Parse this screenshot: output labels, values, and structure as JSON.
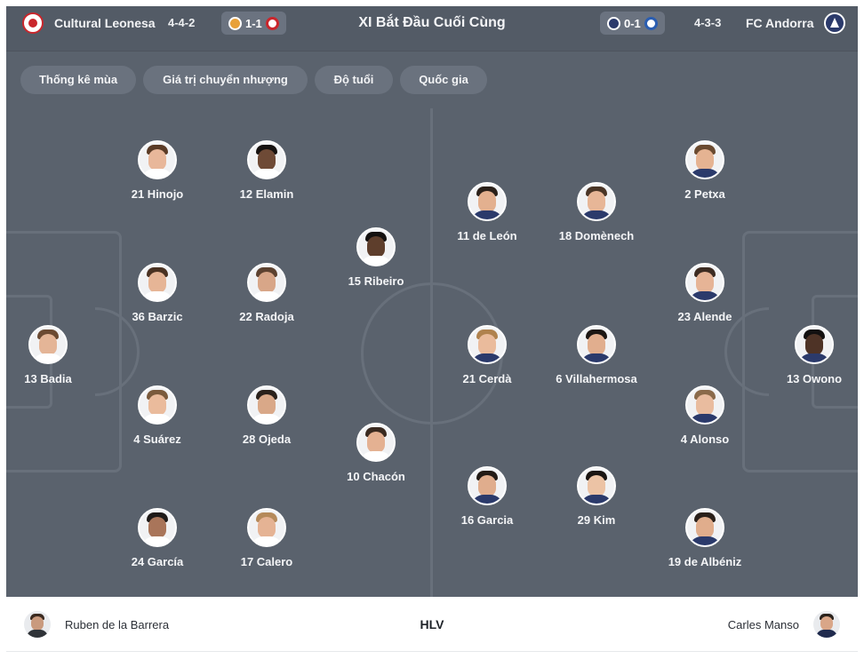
{
  "header": {
    "title": "XI Bắt Đầu Cuối Cùng",
    "home": {
      "name": "Cultural Leonesa",
      "formation": "4-4-2",
      "last_score": "1-1",
      "crest_icon": "cultural-leonesa-crest-icon"
    },
    "away": {
      "name": "FC Andorra",
      "formation": "4-3-3",
      "last_score": "0-1",
      "crest_icon": "fc-andorra-crest-icon"
    }
  },
  "tabs": [
    {
      "label": "Thống kê mùa"
    },
    {
      "label": "Giá trị chuyển nhượng"
    },
    {
      "label": "Độ tuổi"
    },
    {
      "label": "Quốc gia"
    }
  ],
  "home_players": [
    {
      "label": "13 Badia"
    },
    {
      "label": "21 Hinojo"
    },
    {
      "label": "36 Barzic"
    },
    {
      "label": "4 Suárez"
    },
    {
      "label": "24 García"
    },
    {
      "label": "12 Elamin"
    },
    {
      "label": "22 Radoja"
    },
    {
      "label": "28 Ojeda"
    },
    {
      "label": "17 Calero"
    },
    {
      "label": "15 Ribeiro"
    },
    {
      "label": "10 Chacón"
    }
  ],
  "away_players": [
    {
      "label": "11 de León"
    },
    {
      "label": "21 Cerdà"
    },
    {
      "label": "16 Garcia"
    },
    {
      "label": "18 Domènech"
    },
    {
      "label": "6 Villahermosa"
    },
    {
      "label": "29 Kim"
    },
    {
      "label": "2 Petxa"
    },
    {
      "label": "23 Alende"
    },
    {
      "label": "4 Alonso"
    },
    {
      "label": "19 de Albéniz"
    },
    {
      "label": "13 Owono"
    }
  ],
  "coaches": {
    "label": "HLV",
    "home": "Ruben de la Barrera",
    "away": "Carles Manso"
  },
  "colors": {
    "pitch": "#5a626d",
    "header": "#535b66",
    "home_accent": "#c9262c",
    "away_accent": "#2b3a6b"
  }
}
